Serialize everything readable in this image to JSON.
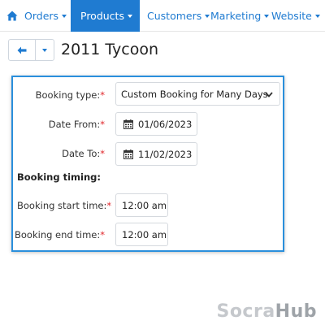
{
  "nav": {
    "items": [
      {
        "label": "Orders",
        "active": false
      },
      {
        "label": "Products",
        "active": true
      },
      {
        "label": "Customers",
        "active": false
      },
      {
        "label": "Marketing",
        "active": false
      },
      {
        "label": "Website",
        "active": false
      }
    ]
  },
  "header": {
    "title": "2011 Tycoon"
  },
  "form": {
    "booking_type": {
      "label": "Booking type:",
      "required_mark": "*",
      "value": "Custom Booking for Many Days"
    },
    "date_from": {
      "label": "Date From:",
      "required_mark": "*",
      "value": "01/06/2023"
    },
    "date_to": {
      "label": "Date To:",
      "required_mark": "*",
      "value": "11/02/2023"
    },
    "timing_section": "Booking timing:",
    "start_time": {
      "label": "Booking start time:",
      "required_mark": "*",
      "value": "12:00 am"
    },
    "end_time": {
      "label": "Booking end time:",
      "required_mark": "*",
      "value": "12:00 am"
    }
  },
  "watermark": {
    "part1": "Socra",
    "part2": "Hub"
  },
  "colors": {
    "accent": "#1f7bd1",
    "panel_border": "#2a8fdc",
    "required": "#e0262b"
  },
  "icons": {
    "home": "home-icon",
    "back": "arrow-left-icon",
    "dropdown": "chevron-down-icon",
    "calendar": "calendar-icon"
  }
}
